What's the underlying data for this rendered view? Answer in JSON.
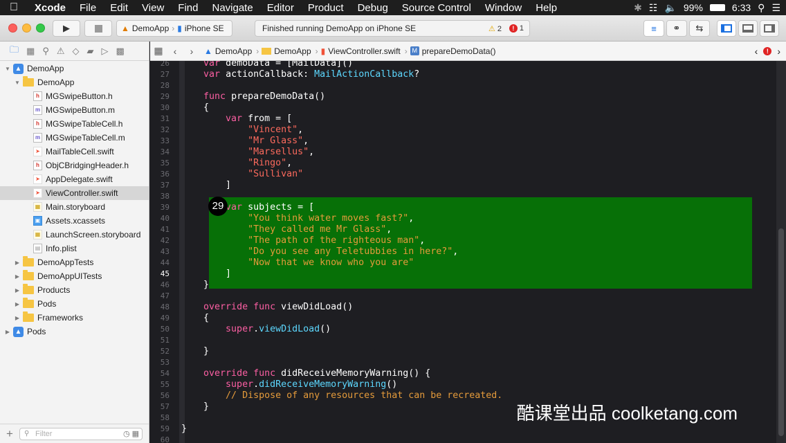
{
  "menubar": {
    "items": [
      "Xcode",
      "File",
      "Edit",
      "View",
      "Find",
      "Navigate",
      "Editor",
      "Product",
      "Debug",
      "Source Control",
      "Window",
      "Help"
    ],
    "battery": "99%",
    "clock": "6:33"
  },
  "toolbar": {
    "scheme": "DemoApp",
    "device": "iPhone SE",
    "status": "Finished running DemoApp on iPhone SE",
    "warnings": "2",
    "errors": "1"
  },
  "navigator": {
    "filter_placeholder": "Filter",
    "tree": [
      {
        "label": "DemoApp",
        "type": "project",
        "depth": 0,
        "open": true
      },
      {
        "label": "DemoApp",
        "type": "folder",
        "depth": 1,
        "open": true
      },
      {
        "label": "MGSwipeButton.h",
        "type": "h",
        "depth": 2
      },
      {
        "label": "MGSwipeButton.m",
        "type": "m",
        "depth": 2
      },
      {
        "label": "MGSwipeTableCell.h",
        "type": "h",
        "depth": 2
      },
      {
        "label": "MGSwipeTableCell.m",
        "type": "m",
        "depth": 2
      },
      {
        "label": "MailTableCell.swift",
        "type": "swift",
        "depth": 2
      },
      {
        "label": "ObjCBridgingHeader.h",
        "type": "h",
        "depth": 2
      },
      {
        "label": "AppDelegate.swift",
        "type": "swift",
        "depth": 2
      },
      {
        "label": "ViewController.swift",
        "type": "swift",
        "depth": 2,
        "selected": true
      },
      {
        "label": "Main.storyboard",
        "type": "storyboard",
        "depth": 2
      },
      {
        "label": "Assets.xcassets",
        "type": "xcassets",
        "depth": 2
      },
      {
        "label": "LaunchScreen.storyboard",
        "type": "storyboard",
        "depth": 2
      },
      {
        "label": "Info.plist",
        "type": "plist",
        "depth": 2
      },
      {
        "label": "DemoAppTests",
        "type": "folder",
        "depth": 1,
        "open": false
      },
      {
        "label": "DemoAppUITests",
        "type": "folder",
        "depth": 1,
        "open": false
      },
      {
        "label": "Products",
        "type": "folder",
        "depth": 1,
        "open": false
      },
      {
        "label": "Pods",
        "type": "folder",
        "depth": 1,
        "open": false
      },
      {
        "label": "Frameworks",
        "type": "folder",
        "depth": 1,
        "open": false
      },
      {
        "label": "Pods",
        "type": "project",
        "depth": 0,
        "open": false
      }
    ]
  },
  "jumpbar": {
    "crumbs": [
      "DemoApp",
      "DemoApp",
      "ViewController.swift",
      "prepareDemoData()"
    ]
  },
  "editor": {
    "step_badge": "29",
    "current_line": 45,
    "lines": [
      {
        "n": 26,
        "t": [
          [
            "    ",
            ""
          ],
          [
            "var",
            "kw"
          ],
          [
            " demoData = [MailData]()",
            ""
          ]
        ]
      },
      {
        "n": 27,
        "t": [
          [
            "    ",
            ""
          ],
          [
            "var",
            "kw"
          ],
          [
            " actionCallback: ",
            ""
          ],
          [
            "MailActionCallback",
            "ty"
          ],
          [
            "?",
            ""
          ]
        ]
      },
      {
        "n": 28,
        "t": []
      },
      {
        "n": 29,
        "t": [
          [
            "    ",
            ""
          ],
          [
            "func",
            "kw"
          ],
          [
            " prepareDemoData()",
            ""
          ]
        ]
      },
      {
        "n": 30,
        "t": [
          [
            "    {",
            ""
          ]
        ]
      },
      {
        "n": 31,
        "t": [
          [
            "        ",
            ""
          ],
          [
            "var",
            "kw"
          ],
          [
            " from = [",
            ""
          ]
        ]
      },
      {
        "n": 32,
        "t": [
          [
            "            ",
            ""
          ],
          [
            "\"Vincent\"",
            "str"
          ],
          [
            ",",
            ""
          ]
        ]
      },
      {
        "n": 33,
        "t": [
          [
            "            ",
            ""
          ],
          [
            "\"Mr Glass\"",
            "str"
          ],
          [
            ",",
            ""
          ]
        ]
      },
      {
        "n": 34,
        "t": [
          [
            "            ",
            ""
          ],
          [
            "\"Marsellus\"",
            "str"
          ],
          [
            ",",
            ""
          ]
        ]
      },
      {
        "n": 35,
        "t": [
          [
            "            ",
            ""
          ],
          [
            "\"Ringo\"",
            "str"
          ],
          [
            ",",
            ""
          ]
        ]
      },
      {
        "n": 36,
        "t": [
          [
            "            ",
            ""
          ],
          [
            "\"Sullivan\"",
            "str"
          ]
        ]
      },
      {
        "n": 37,
        "t": [
          [
            "        ]",
            ""
          ]
        ]
      },
      {
        "n": 38,
        "t": []
      },
      {
        "n": 39,
        "t": [
          [
            "        ",
            ""
          ],
          [
            "var",
            "kw"
          ],
          [
            " subjects = [",
            ""
          ]
        ]
      },
      {
        "n": 40,
        "t": [
          [
            "            ",
            ""
          ],
          [
            "\"You think water moves fast?\"",
            "strh"
          ],
          [
            ",",
            ""
          ]
        ]
      },
      {
        "n": 41,
        "t": [
          [
            "            ",
            ""
          ],
          [
            "\"They called me Mr Glass\"",
            "strh"
          ],
          [
            ",",
            ""
          ]
        ]
      },
      {
        "n": 42,
        "t": [
          [
            "            ",
            ""
          ],
          [
            "\"The path of the righteous man\"",
            "strh"
          ],
          [
            ",",
            ""
          ]
        ]
      },
      {
        "n": 43,
        "t": [
          [
            "            ",
            ""
          ],
          [
            "\"Do you see any Teletubbies in here?\"",
            "strh"
          ],
          [
            ",",
            ""
          ]
        ]
      },
      {
        "n": 44,
        "t": [
          [
            "            ",
            ""
          ],
          [
            "\"Now that we know who you are\"",
            "strh"
          ]
        ]
      },
      {
        "n": 45,
        "t": [
          [
            "        ]",
            ""
          ]
        ]
      },
      {
        "n": 46,
        "t": [
          [
            "    }",
            ""
          ]
        ]
      },
      {
        "n": 47,
        "t": []
      },
      {
        "n": 48,
        "t": [
          [
            "    ",
            ""
          ],
          [
            "override",
            "kw"
          ],
          [
            " ",
            ""
          ],
          [
            "func",
            "kw"
          ],
          [
            " viewDidLoad()",
            ""
          ]
        ]
      },
      {
        "n": 49,
        "t": [
          [
            "    {",
            ""
          ]
        ]
      },
      {
        "n": 50,
        "t": [
          [
            "        ",
            ""
          ],
          [
            "super",
            "kw"
          ],
          [
            ".",
            ""
          ],
          [
            "viewDidLoad",
            "fn"
          ],
          [
            "()",
            ""
          ]
        ]
      },
      {
        "n": 51,
        "t": []
      },
      {
        "n": 52,
        "t": [
          [
            "    }",
            ""
          ]
        ]
      },
      {
        "n": 53,
        "t": []
      },
      {
        "n": 54,
        "t": [
          [
            "    ",
            ""
          ],
          [
            "override",
            "kw"
          ],
          [
            " ",
            ""
          ],
          [
            "func",
            "kw"
          ],
          [
            " didReceiveMemoryWarning() {",
            ""
          ]
        ]
      },
      {
        "n": 55,
        "t": [
          [
            "        ",
            ""
          ],
          [
            "super",
            "kw"
          ],
          [
            ".",
            ""
          ],
          [
            "didReceiveMemoryWarning",
            "fn"
          ],
          [
            "()",
            ""
          ]
        ]
      },
      {
        "n": 56,
        "t": [
          [
            "        ",
            ""
          ],
          [
            "// Dispose of any resources that can be recreated.",
            "cm"
          ]
        ]
      },
      {
        "n": 57,
        "t": [
          [
            "    }",
            ""
          ]
        ]
      },
      {
        "n": 58,
        "t": []
      },
      {
        "n": 59,
        "t": [
          [
            "}",
            ""
          ]
        ]
      },
      {
        "n": 60,
        "t": []
      }
    ]
  },
  "watermark": "酷课堂出品 coolketang.com"
}
